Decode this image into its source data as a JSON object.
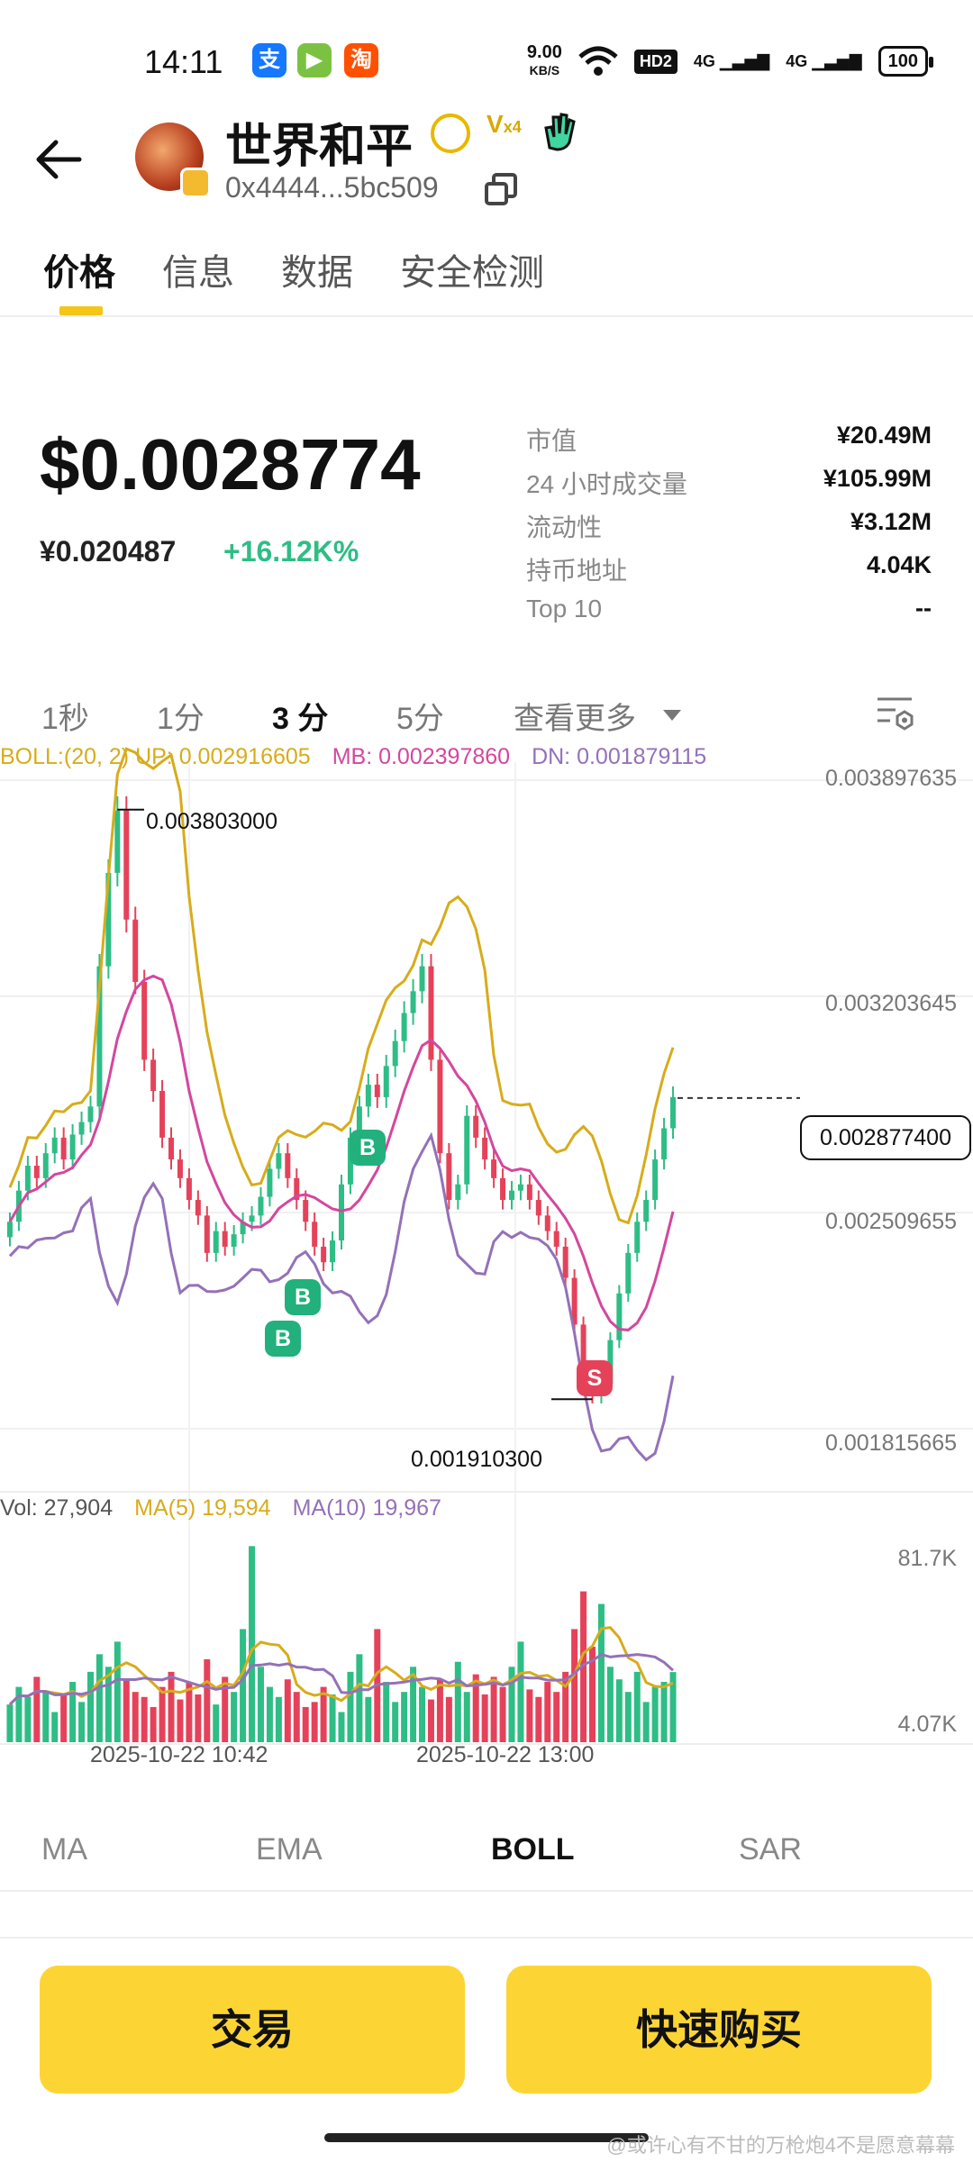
{
  "status_bar": {
    "time": "14:11",
    "apps": [
      "alipay-icon",
      "video-icon",
      "taobao-icon"
    ],
    "net_speed_value": "9.00",
    "net_speed_unit": "KB/S",
    "hd_badge": "HD2",
    "sig1": "4G",
    "sig2": "4G",
    "battery": "100"
  },
  "header": {
    "name": "世界和平",
    "address": "0x4444...5bc509",
    "v_badge": "V",
    "v_mult": "x4"
  },
  "tabs": [
    "价格",
    "信息",
    "数据",
    "安全检测"
  ],
  "price": {
    "usd": "$0.0028774",
    "cny": "¥0.020487",
    "change": "+16.12K%"
  },
  "stats": [
    {
      "k": "市值",
      "v": "¥20.49M"
    },
    {
      "k": "24 小时成交量",
      "v": "¥105.99M"
    },
    {
      "k": "流动性",
      "v": "¥3.12M"
    },
    {
      "k": "持币地址",
      "v": "4.04K"
    },
    {
      "k": "Top 10",
      "v": "--"
    }
  ],
  "timeframes": [
    "1秒",
    "1分",
    "3 分",
    "5分",
    "查看更多"
  ],
  "indicator": {
    "up": "BOLL:(20, 2) UP: 0.002916605",
    "mb": "MB: 0.002397860",
    "dn": "DN: 0.001879115"
  },
  "volume_indicator": {
    "vol": "Vol: 27,904",
    "ma5": "MA(5) 19,594",
    "ma10": "MA(10) 19,967"
  },
  "chart_data": {
    "type": "candlestick",
    "y_axis_labels": [
      "0.003897635",
      "0.003203645",
      "0.002509655",
      "0.001815665"
    ],
    "ylim": [
      0.001815665,
      0.003897635
    ],
    "volume_axis_labels": [
      "81.7K",
      "4.07K"
    ],
    "x_axis_labels": [
      "2025-10-22 10:42",
      "2025-10-22 13:00"
    ],
    "current_price_label": "0.002877400",
    "high_annotation": "0.003803000",
    "low_annotation": "0.001910300",
    "markers": [
      "B",
      "B",
      "B",
      "S"
    ],
    "close_series": [
      0.00248,
      0.00258,
      0.00266,
      0.00262,
      0.0027,
      0.00275,
      0.00268,
      0.00276,
      0.0028,
      0.00285,
      0.0033,
      0.0036,
      0.0038,
      0.00345,
      0.00325,
      0.003,
      0.0029,
      0.00275,
      0.00268,
      0.00262,
      0.00255,
      0.0025,
      0.00238,
      0.00245,
      0.0024,
      0.00244,
      0.00248,
      0.0025,
      0.00256,
      0.00265,
      0.0027,
      0.00262,
      0.00255,
      0.00248,
      0.0024,
      0.00235,
      0.00242,
      0.0026,
      0.00275,
      0.00285,
      0.00292,
      0.00288,
      0.00298,
      0.00306,
      0.00315,
      0.00322,
      0.0033,
      0.003,
      0.0027,
      0.00255,
      0.0026,
      0.00282,
      0.00275,
      0.00268,
      0.00262,
      0.00255,
      0.00258,
      0.0026,
      0.00255,
      0.0025,
      0.00245,
      0.0024,
      0.0023,
      0.00215,
      0.002,
      0.00192,
      0.00196,
      0.0021,
      0.00225,
      0.00238,
      0.00248,
      0.00255,
      0.00268,
      0.00278,
      0.00288
    ],
    "volume_series": [
      15000,
      22000,
      18000,
      26000,
      20000,
      12000,
      19000,
      24000,
      16000,
      28000,
      35000,
      30000,
      40000,
      25000,
      20000,
      18000,
      14000,
      22000,
      28000,
      17000,
      24000,
      19000,
      33000,
      15000,
      26000,
      20000,
      45000,
      78000,
      30000,
      22000,
      18000,
      25000,
      20000,
      14000,
      16000,
      22000,
      19000,
      12000,
      28000,
      35000,
      18000,
      45000,
      24000,
      16000,
      20000,
      30000,
      22000,
      17000,
      25000,
      18000,
      32000,
      20000,
      27000,
      19000,
      26000,
      22000,
      30000,
      40000,
      21000,
      18000,
      24000,
      20000,
      28000,
      45000,
      60000,
      38000,
      55000,
      30000,
      25000,
      20000,
      28000,
      16000,
      22000,
      24000,
      27904
    ]
  },
  "indicator_tabs": [
    "MA",
    "EMA",
    "BOLL",
    "SAR"
  ],
  "buttons": {
    "trade": "交易",
    "quick_buy": "快速购买"
  },
  "watermark": "@或许心有不甘的万枪炮4不是愿意幕幕"
}
